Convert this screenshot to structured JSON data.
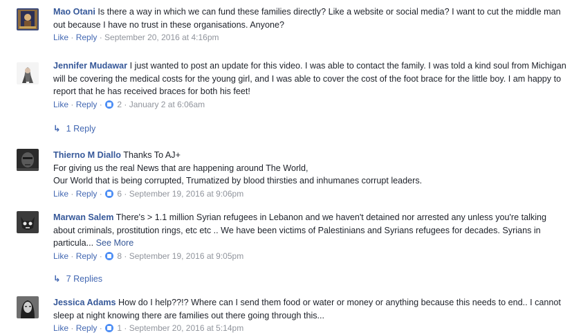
{
  "comments": [
    {
      "author": "Mao Otani",
      "text": " Is there a way in which we can fund these families directly? Like a website or social media? I want to cut the middle man out because I have no trust in these organisations. Anyone?",
      "like": "Like",
      "reply": "Reply",
      "timestamp": "September 20, 2016 at 4:16pm"
    },
    {
      "author": "Jennifer Mudawar",
      "text": " I just wanted to post an update for this video. I was able to contact the family. I was told a kind soul from Michigan will be covering the medical costs for the young girl, and I was able to cover the cost of the foot brace for the little boy. I am happy to report that he has received braces for both his feet!",
      "like": "Like",
      "reply": "Reply",
      "reactions": "2",
      "timestamp": "January 2 at 6:06am",
      "replies": "1 Reply"
    },
    {
      "author": "Thierno M Diallo",
      "text_lines": [
        " Thanks To AJ+",
        "For giving us the real News that are happening around The World,",
        "Our World that is being corrupted, Trumatized by blood thirsties and inhumanes corrupt leaders."
      ],
      "like": "Like",
      "reply": "Reply",
      "reactions": "6",
      "timestamp": "September 19, 2016 at 9:06pm"
    },
    {
      "author": "Marwan Salem",
      "text": " There's > 1.1 million Syrian refugees in Lebanon and we haven't detained nor arrested any unless you're talking about criminals, prostitution rings, etc etc .. We have been victims of Palestinians and Syrians refugees for decades. Syrians in particula...",
      "see_more": "See More",
      "like": "Like",
      "reply": "Reply",
      "reactions": "8",
      "timestamp": "September 19, 2016 at 9:05pm",
      "replies": "7 Replies"
    },
    {
      "author": "Jessica Adams",
      "text": " How do I help??!? Where can I send them food or water or money or anything because this needs to end.. I cannot sleep at night knowing there are families out there going through this...",
      "like": "Like",
      "reply": "Reply",
      "reactions": "1",
      "timestamp": "September 20, 2016 at 5:14pm"
    }
  ],
  "separator": " · ",
  "colors": {
    "author": "#365899",
    "action": "#4267b2",
    "meta": "#90949c",
    "text": "#1d2129",
    "reaction_badge": "#4d8ef5"
  },
  "icons": {
    "reaction": "like-reaction-icon",
    "reply_arrow": "reply-arrow-icon"
  }
}
